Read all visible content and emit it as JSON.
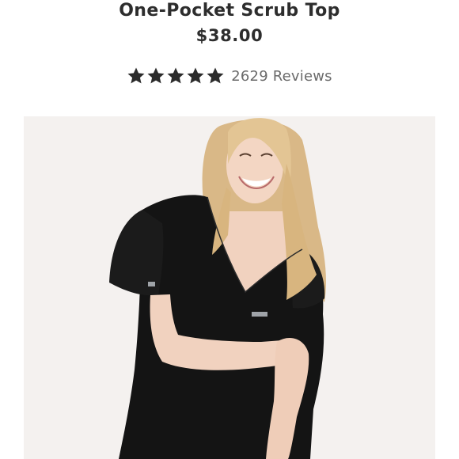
{
  "product": {
    "title": "One-Pocket Scrub Top",
    "price": "$38.00"
  },
  "rating": {
    "stars": 5,
    "max_stars": 5,
    "reviews_text": "2629 Reviews",
    "star_color": "#2b2b2b"
  },
  "photo": {
    "icon": "product-photo",
    "background": "#f4f1ef",
    "garment_color": "#141414"
  }
}
